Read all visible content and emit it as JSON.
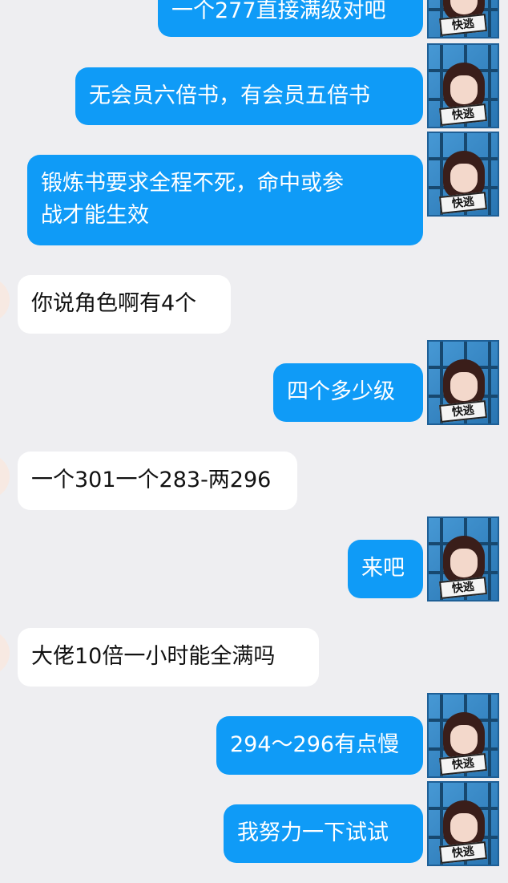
{
  "messages": [
    {
      "side": "out",
      "text": "一个277直接满级对吧",
      "avatar_sign": "快逃"
    },
    {
      "side": "out",
      "text": "无会员六倍书，有会员五倍书",
      "avatar_sign": "快逃"
    },
    {
      "side": "out",
      "lines": [
        "锻炼书要求全程不死，命中或参",
        "战才能生效"
      ],
      "avatar_sign": "快逃"
    },
    {
      "side": "in",
      "text": "你说角色啊有4个"
    },
    {
      "side": "out",
      "text": "四个多少级",
      "avatar_sign": "快逃"
    },
    {
      "side": "in",
      "text": "一个301一个283-两296"
    },
    {
      "side": "out",
      "text": "来吧",
      "avatar_sign": "快逃"
    },
    {
      "side": "in",
      "text": "大佬10倍一小时能全满吗"
    },
    {
      "side": "out",
      "text": "294～296有点慢",
      "avatar_sign": "快逃"
    },
    {
      "side": "out",
      "text": "我努力一下试试",
      "avatar_sign": "快逃"
    }
  ],
  "colors": {
    "background": "#eeeef1",
    "outgoing_bubble": "#0f9bf7",
    "incoming_bubble": "#ffffff"
  },
  "icons": {
    "self_avatar": "anime-girl-avatar-icon",
    "peer_avatar": "peer-avatar-icon"
  }
}
